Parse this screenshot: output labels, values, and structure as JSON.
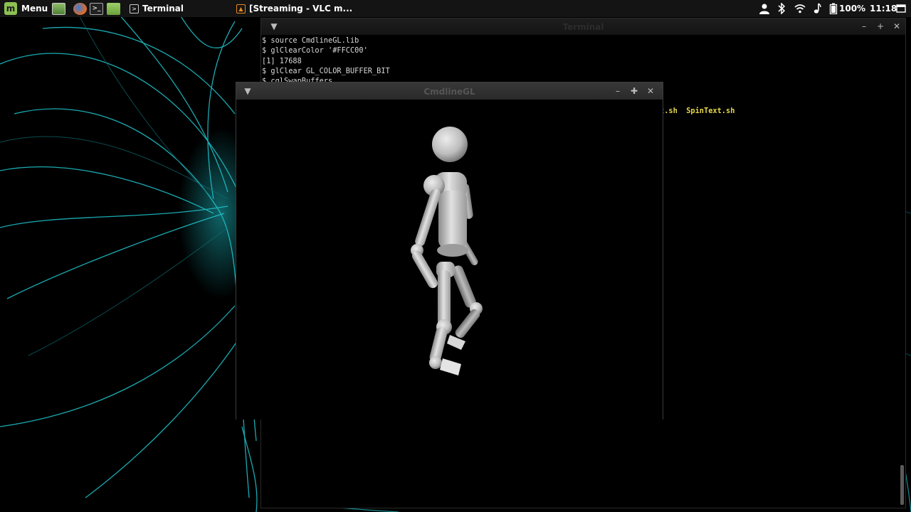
{
  "panel": {
    "menu_label": "Menu",
    "tasks": [
      {
        "label": "Terminal"
      },
      {
        "label": "[Streaming - VLC m..."
      }
    ],
    "battery": "100%",
    "clock": "11:18"
  },
  "terminal": {
    "title": "Terminal",
    "lines": [
      "$ source CmdlineGL.lib",
      "$ glClearColor '#FFCC00'",
      "[1] 17688",
      "$ glClear GL_COLOR_BUFFER_BIT",
      "$ cglSwapBuffers"
    ],
    "files_visible": "t.sh  SpinText.sh"
  },
  "gl_window": {
    "title": "CmdlineGL"
  },
  "colors": {
    "panel_bg": "#141414",
    "file_highlight": "#e5d84b",
    "wallpaper_accent": "#1fc8d0"
  }
}
